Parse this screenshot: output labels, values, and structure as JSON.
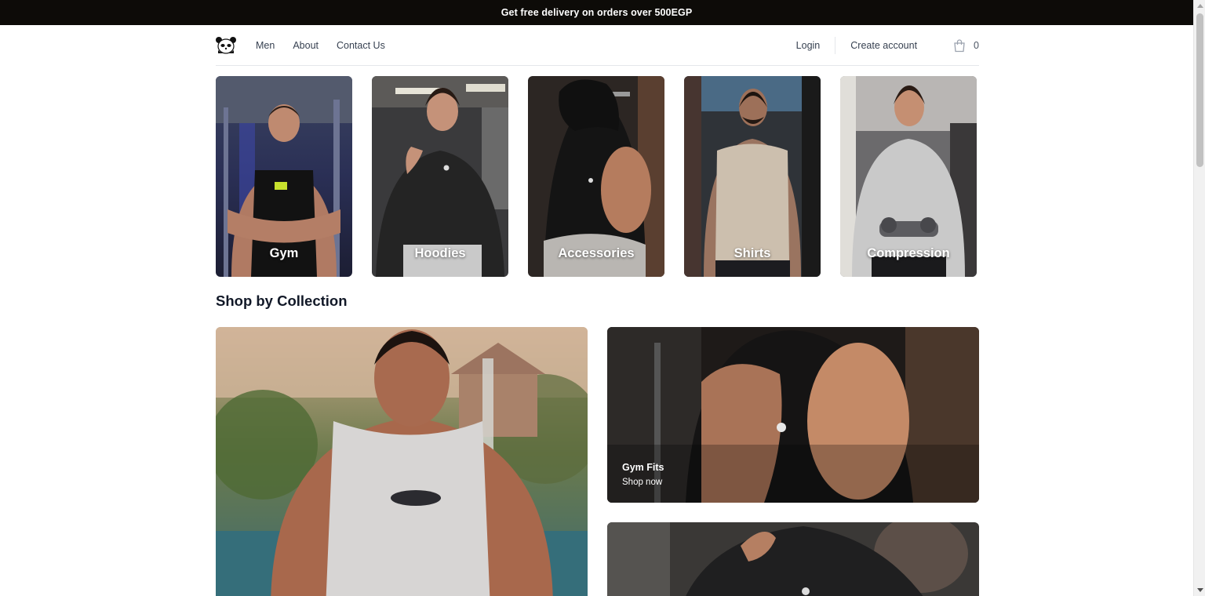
{
  "announcement": {
    "text": "Get free delivery on orders over 500EGP"
  },
  "header": {
    "logo_icon": "panda-logo-icon",
    "nav": [
      {
        "label": "Men"
      },
      {
        "label": "About"
      },
      {
        "label": "Contact Us"
      }
    ],
    "login_label": "Login",
    "create_account_label": "Create account",
    "cart_icon": "shopping-bag-icon",
    "cart_count": "0"
  },
  "categories": [
    {
      "label": "Gym"
    },
    {
      "label": "Hoodies"
    },
    {
      "label": "Accessories"
    },
    {
      "label": "Shirts"
    },
    {
      "label": "Compression"
    }
  ],
  "collections": {
    "section_title": "Shop by Collection",
    "items": [
      {
        "title": "Gym Fits",
        "cta": "Shop now"
      }
    ]
  },
  "colors": {
    "announcement_bg": "#0d0b08",
    "text": "#111827",
    "nav_text": "#374151",
    "border": "#e5e7eb"
  }
}
